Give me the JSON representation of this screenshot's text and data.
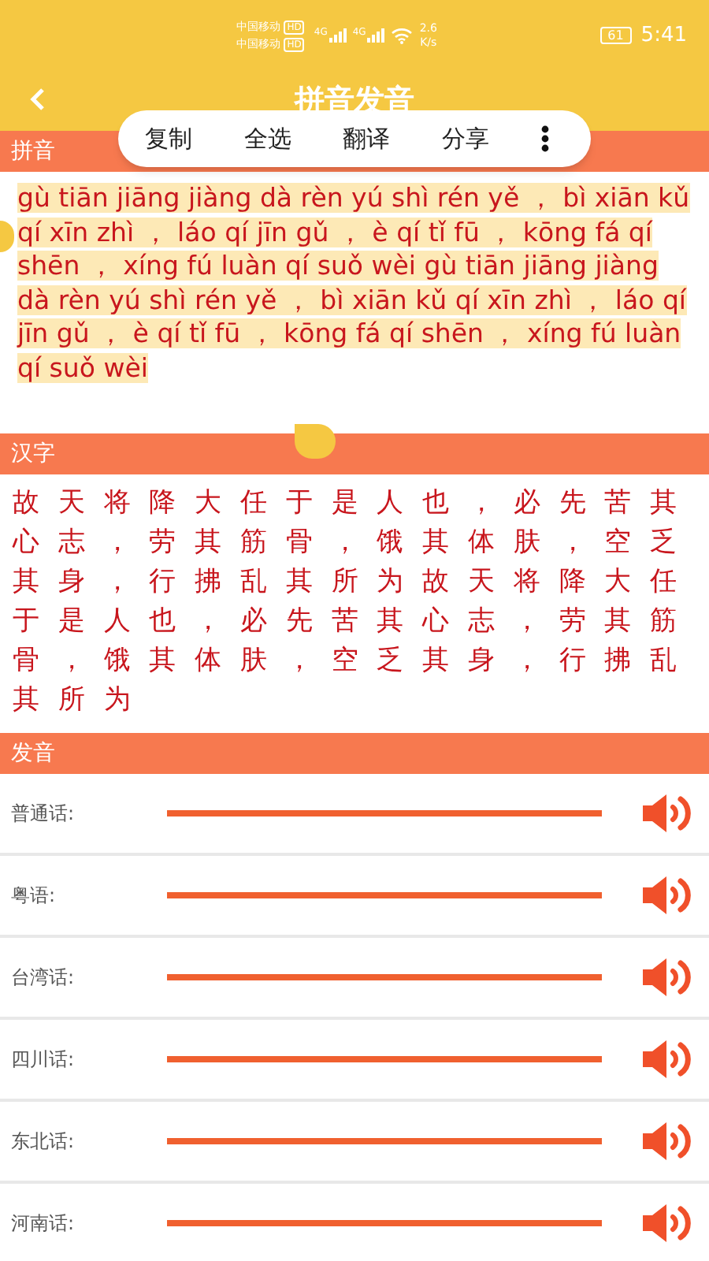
{
  "status_bar": {
    "carriers": [
      {
        "name": "中国移动",
        "badge": "HD"
      },
      {
        "name": "中国移动",
        "badge": "HD"
      }
    ],
    "network": [
      "4G",
      "4G"
    ],
    "speed": "2.6",
    "speed_unit": "K/s",
    "battery": "61",
    "time": "5:41"
  },
  "header": {
    "title": "拼音发音"
  },
  "selection_menu": {
    "items": [
      "复制",
      "全选",
      "翻译",
      "分享"
    ]
  },
  "pinyin": {
    "heading": "拼音",
    "selected_text": "gù tiān jiāng jiàng dà rèn yú shì rén yě ，  bì xiān kǔ qí xīn zhì ，  láo qí jīn gǔ ，  è qí tǐ fū ，  kōng fá qí shēn ，  xíng fú luàn qí suǒ wèi gù tiān jiāng jiàng dà rèn yú shì rén yě ，  bì xiān kǔ qí xīn zhì ，  láo qí jīn gǔ ，  è qí tǐ fū ，  kōng fá qí shēn ，  xíng fú luàn qí suǒ wèi",
    "selected": true
  },
  "hanzi": {
    "heading": "汉字",
    "text": "故天将降大任于是人也，必先苦其心志，劳其筋骨，饿其体肤，空乏其身，行拂乱其所为故天将降大任于是人也，必先苦其心志，劳其筋骨，饿其体肤，空乏其身，行拂乱其所为"
  },
  "pronunciation": {
    "heading": "发音",
    "rows": [
      {
        "label": "普通话:"
      },
      {
        "label": "粤语:"
      },
      {
        "label": "台湾话:"
      },
      {
        "label": "四川话:"
      },
      {
        "label": "东北话:"
      },
      {
        "label": "河南话:"
      }
    ]
  }
}
